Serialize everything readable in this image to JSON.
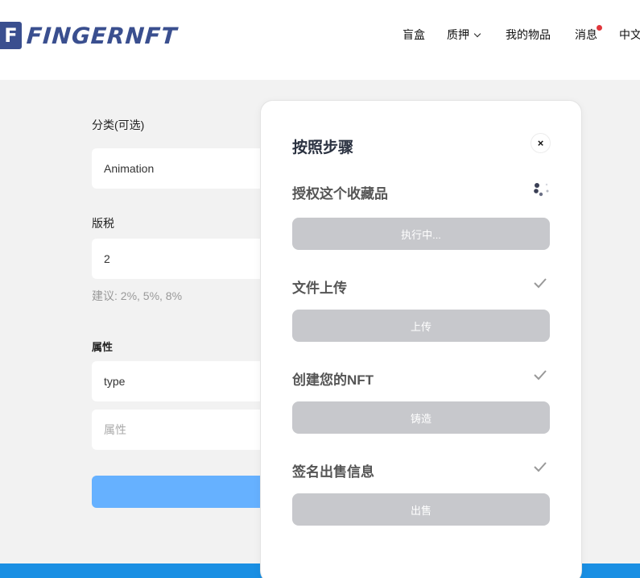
{
  "header": {
    "logo_mark": "F",
    "logo_text": "FINGERNFT",
    "nav": {
      "blind_box": "盲盒",
      "pledge": "质押",
      "my_items": "我的物品",
      "messages": "消息",
      "language": "中文"
    }
  },
  "form": {
    "category_label": "分类(可选)",
    "category_value": "Animation",
    "royalty_label": "版税",
    "royalty_value": "2",
    "royalty_hint": "建议: 2%, 5%, 8%",
    "attributes_label": "属性",
    "attribute_type_value": "type",
    "attribute_value_placeholder": "属性"
  },
  "modal": {
    "title": "按照步骤",
    "close_symbol": "×",
    "steps": [
      {
        "title": "授权这个收藏品",
        "button": "执行中...",
        "status": "loading"
      },
      {
        "title": "文件上传",
        "button": "上传",
        "status": "done"
      },
      {
        "title": "创建您的NFT",
        "button": "铸造",
        "status": "done"
      },
      {
        "title": "签名出售信息",
        "button": "出售",
        "status": "done"
      }
    ]
  },
  "colors": {
    "brand": "#3a4f8f",
    "step_button": "#c7c8cc",
    "submit_button": "#66b1ff",
    "footer_bar": "#1a8fe3",
    "notification_dot": "#e0363b"
  }
}
